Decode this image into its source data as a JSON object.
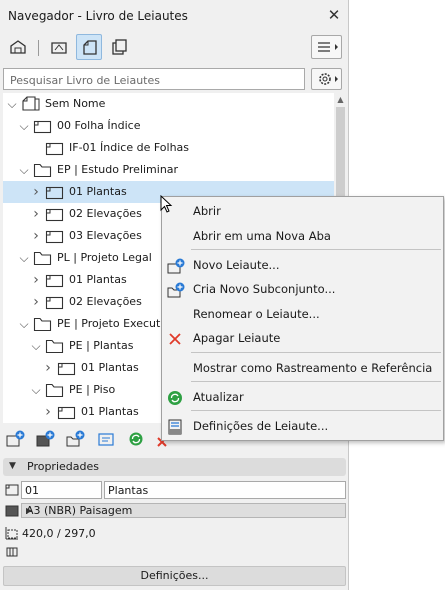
{
  "window": {
    "title": "Navegador - Livro de Leiautes",
    "close": "✕"
  },
  "search": {
    "placeholder": "Pesquisar Livro de Leiautes",
    "value": ""
  },
  "tree": [
    {
      "label": "Sem Nome",
      "chevron": "v",
      "icon": "book-icon",
      "level": 0
    },
    {
      "label": "00 Folha Índice",
      "chevron": "v",
      "icon": "layout-icon",
      "level": 1
    },
    {
      "label": "IF-01 Índice de Folhas",
      "chevron": "",
      "icon": "layout-icon",
      "level": 2
    },
    {
      "label": "EP | Estudo Preliminar",
      "chevron": "v",
      "icon": "folder-icon",
      "level": 1
    },
    {
      "label": "01 Plantas",
      "chevron": ">",
      "icon": "layout-icon",
      "level": 2,
      "selected": true
    },
    {
      "label": "02 Elevações",
      "chevron": ">",
      "icon": "layout-icon",
      "level": 2
    },
    {
      "label": "03 Elevações",
      "chevron": ">",
      "icon": "layout-icon",
      "level": 2
    },
    {
      "label": "PL | Projeto Legal",
      "chevron": "v",
      "icon": "folder-icon",
      "level": 1
    },
    {
      "label": "01 Plantas",
      "chevron": ">",
      "icon": "layout-icon",
      "level": 2
    },
    {
      "label": "02 Elevações",
      "chevron": ">",
      "icon": "layout-icon",
      "level": 2
    },
    {
      "label": "PE | Projeto Executivo",
      "chevron": "v",
      "icon": "folder-icon",
      "level": 1
    },
    {
      "label": "PE | Plantas",
      "chevron": "v",
      "icon": "folder-icon",
      "level": 2
    },
    {
      "label": "01 Plantas",
      "chevron": ">",
      "icon": "layout-icon",
      "level": 3
    },
    {
      "label": "PE | Piso",
      "chevron": "v",
      "icon": "folder-icon",
      "level": 2
    },
    {
      "label": "01 Plantas",
      "chevron": ">",
      "icon": "layout-icon",
      "level": 3
    }
  ],
  "properties": {
    "header": "Propriedades",
    "id_value": "01",
    "name_value": "Plantas",
    "size_option": "A3 (NBR) Paisagem",
    "dimensions": "420,0 / 297,0",
    "settings_button": "Definições..."
  },
  "context_menu": {
    "items": [
      {
        "label": "Abrir",
        "icon": ""
      },
      {
        "label": "Abrir em uma Nova Aba",
        "icon": ""
      },
      {
        "label": "Novo Leiaute...",
        "icon": "new-layout-icon"
      },
      {
        "label": "Cria Novo Subconjunto...",
        "icon": "new-subset-icon"
      },
      {
        "label": "Renomear o Leiaute...",
        "icon": ""
      },
      {
        "label": "Apagar Leiaute",
        "icon": "delete-x-icon"
      },
      {
        "label": "Mostrar como Rastreamento e Referência",
        "icon": ""
      },
      {
        "label": "Atualizar",
        "icon": "refresh-icon"
      },
      {
        "label": "Definições de Leiaute...",
        "icon": "layout-settings-icon"
      }
    ]
  },
  "colors": {
    "selection": "#cde4f7",
    "accent_blue": "#2a7ad5",
    "delete_red": "#e03a2a",
    "refresh_green": "#2ea043"
  }
}
